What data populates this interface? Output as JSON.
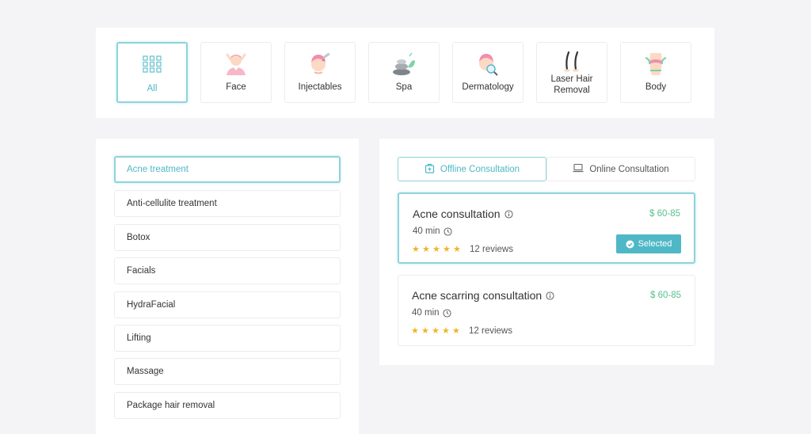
{
  "categories": [
    {
      "label": "All",
      "icon": "grid-icon",
      "active": true
    },
    {
      "label": "Face",
      "icon": "face-care-icon"
    },
    {
      "label": "Injectables",
      "icon": "injection-icon"
    },
    {
      "label": "Spa",
      "icon": "spa-stones-icon"
    },
    {
      "label": "Dermatology",
      "icon": "dermatology-icon"
    },
    {
      "label": "Laser Hair Removal",
      "line1": "Laser Hair",
      "line2": "Removal",
      "icon": "hair-removal-icon"
    },
    {
      "label": "Body",
      "icon": "body-icon"
    }
  ],
  "services": [
    "Acne treatment",
    "Anti-cellulite treatment",
    "Botox",
    "Facials",
    "HydraFacial",
    "Lifting",
    "Massage",
    "Package hair removal"
  ],
  "active_service": "Acne treatment",
  "tabs": {
    "offline": "Offline Consultation",
    "online": "Online Consultation"
  },
  "consultations": [
    {
      "title": "Acne consultation",
      "price": "$ 60-85",
      "duration": "40 min",
      "stars": 5,
      "reviews": "12 reviews",
      "selected": true
    },
    {
      "title": "Acne scarring consultation",
      "price": "$ 60-85",
      "duration": "40 min",
      "stars": 5,
      "reviews": "12 reviews",
      "selected": false
    }
  ],
  "selected_label": "Selected",
  "colors": {
    "accent": "#4fb8c7",
    "price": "#55c08f",
    "star": "#f0b429"
  }
}
